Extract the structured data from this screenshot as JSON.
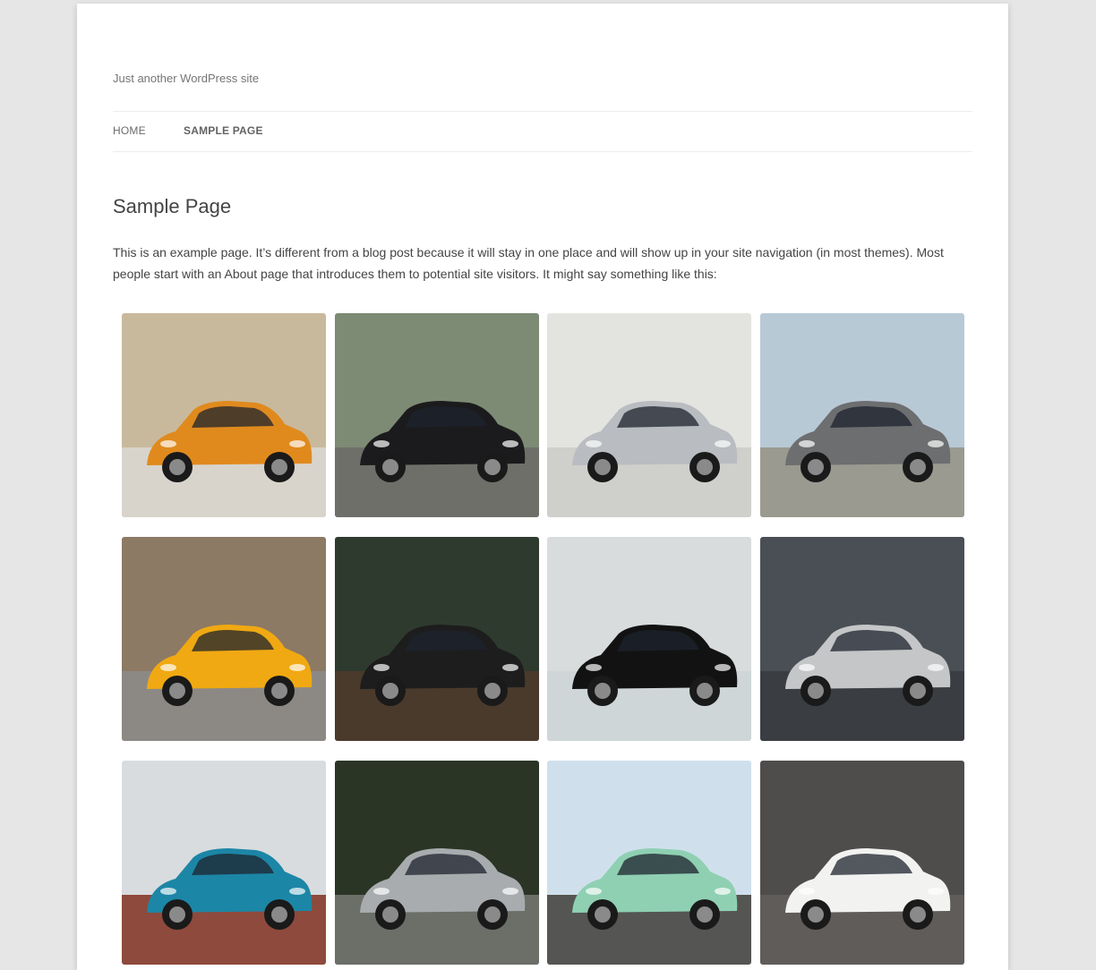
{
  "site": {
    "tagline": "Just another WordPress site"
  },
  "nav": {
    "items": [
      {
        "label": "Home",
        "current": false
      },
      {
        "label": "Sample Page",
        "current": true
      }
    ]
  },
  "page": {
    "title": "Sample Page",
    "intro": "This is an example page. It’s different from a blog post because it will stay in one place and will show up in your site navigation (in most themes). Most people start with an About page that introduces them to potential site visitors. It might say something like this:"
  },
  "gallery": {
    "images": [
      {
        "bg": "#c9b99c",
        "car": "#e08a1e",
        "ground": "#d8d4cc"
      },
      {
        "bg": "#7d8a74",
        "car": "#1b1b1d",
        "ground": "#6f6f6a"
      },
      {
        "bg": "#e3e3e0",
        "car": "#b9bcc0",
        "ground": "#cfcfcc"
      },
      {
        "bg": "#b8c9d6",
        "car": "#6d6e70",
        "ground": "#9a9a90"
      },
      {
        "bg": "#8d7a64",
        "car": "#f0a912",
        "ground": "#8c8985"
      },
      {
        "bg": "#2f3a2e",
        "car": "#1d1d1d",
        "ground": "#4a3a2c"
      },
      {
        "bg": "#d9dcdc",
        "car": "#121212",
        "ground": "#cfd6d8"
      },
      {
        "bg": "#4a4f55",
        "car": "#c4c6c8",
        "ground": "#3a3d42"
      },
      {
        "bg": "#d8dcde",
        "car": "#1c86a6",
        "ground": "#8e4a3c"
      },
      {
        "bg": "#2b3526",
        "car": "#a9acae",
        "ground": "#6b6f68"
      },
      {
        "bg": "#cfe0ec",
        "car": "#8fd0b2",
        "ground": "#555553"
      },
      {
        "bg": "#4f4d4c",
        "car": "#f2f2f0",
        "ground": "#5f5c5a"
      }
    ]
  }
}
